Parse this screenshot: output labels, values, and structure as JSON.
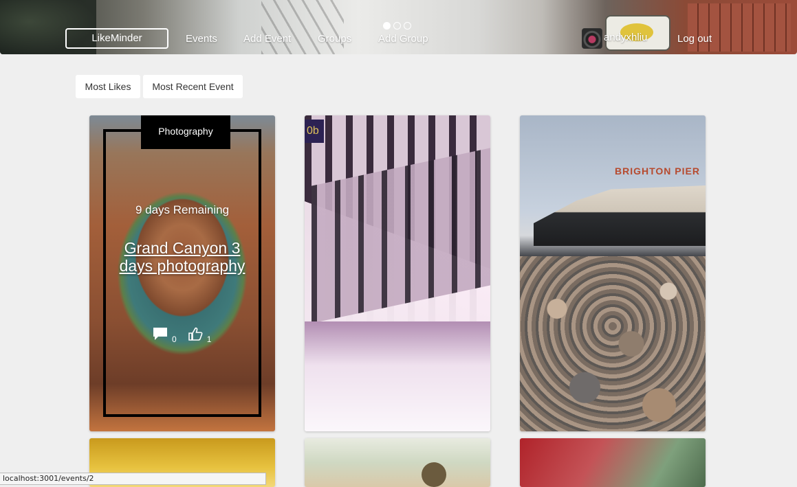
{
  "nav": {
    "brand": "LikeMinder",
    "links": [
      "Events",
      "Add Event",
      "Groups",
      "Add Group"
    ],
    "username": "andyxhliu",
    "logout": "Log out",
    "carousel_active": 1,
    "carousel_count": 3
  },
  "sort": {
    "most_likes": "Most Likes",
    "most_recent": "Most Recent Event"
  },
  "featured_card": {
    "category": "Photography",
    "remaining": "9 days Remaining",
    "title": "Grand Canyon 3 days photography",
    "comments": "0",
    "likes": "1"
  },
  "status_bar": {
    "url": "localhost:3001/events/2"
  }
}
